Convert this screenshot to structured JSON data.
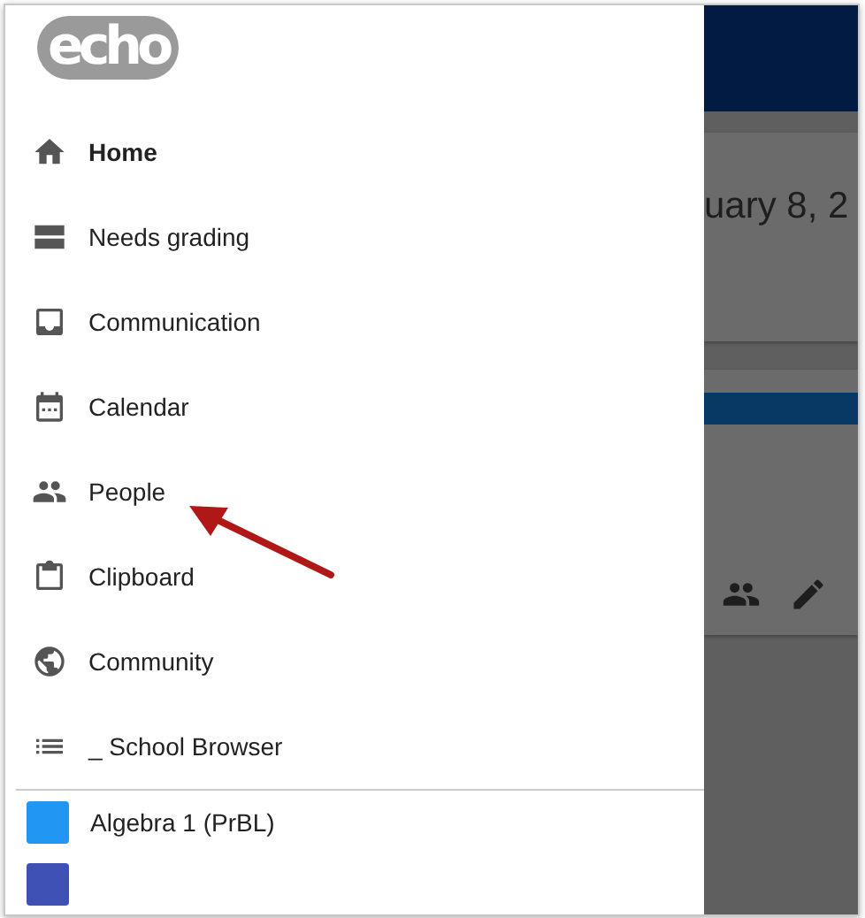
{
  "drawer": {
    "logo": "echo",
    "items": [
      {
        "kind": "home",
        "label": "Home",
        "selected": true
      },
      {
        "kind": "grading",
        "label": "Needs grading",
        "selected": false
      },
      {
        "kind": "inbox",
        "label": "Communication",
        "selected": false
      },
      {
        "kind": "calendar",
        "label": "Calendar",
        "selected": false
      },
      {
        "kind": "people",
        "label": "People",
        "selected": false
      },
      {
        "kind": "clipboard",
        "label": "Clipboard",
        "selected": false
      },
      {
        "kind": "globe",
        "label": "Community",
        "selected": false
      },
      {
        "kind": "list",
        "label": "_ School Browser",
        "selected": false
      }
    ],
    "courses": [
      {
        "label": "Algebra 1 (PrBL)",
        "color": "#2196f3"
      },
      {
        "color": "#3f51b5"
      }
    ]
  },
  "background": {
    "date_text": "uary 8, 2"
  }
}
